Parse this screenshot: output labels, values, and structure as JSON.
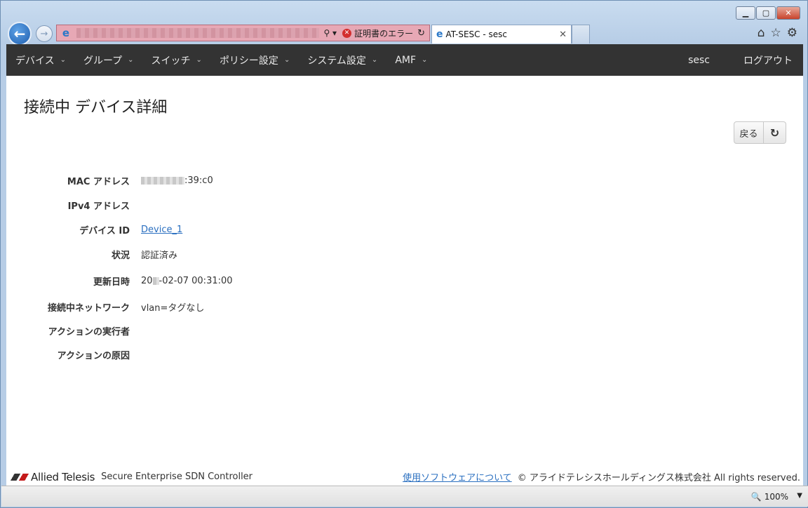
{
  "browser": {
    "address_error": "証明書のエラー",
    "tab_title": "AT-SESC - sesc",
    "zoom": "100%"
  },
  "nav": {
    "items": [
      {
        "label": "デバイス"
      },
      {
        "label": "グループ"
      },
      {
        "label": "スイッチ"
      },
      {
        "label": "ポリシー設定"
      },
      {
        "label": "システム設定"
      },
      {
        "label": "AMF"
      }
    ],
    "user": "sesc",
    "logout": "ログアウト"
  },
  "page": {
    "title": "接続中 デバイス詳細",
    "back_button": "戻る"
  },
  "details": {
    "mac_label": "MAC アドレス",
    "mac_value_suffix": ":39:c0",
    "ipv4_label": "IPv4 アドレス",
    "ipv4_value": "",
    "device_id_label": "デバイス ID",
    "device_id_value": "Device_1",
    "status_label": "状況",
    "status_value": "認証済み",
    "updated_label": "更新日時",
    "updated_prefix": "20",
    "updated_suffix": "-02-07 00:31:00",
    "network_label": "接続中ネットワーク",
    "network_value": "vlan=タグなし",
    "actor_label": "アクションの実行者",
    "cause_label": "アクションの原因"
  },
  "footer": {
    "brand": "Allied Telesis",
    "product": "Secure Enterprise SDN Controller",
    "software_link": "使用ソフトウェアについて",
    "copyright": "© アライドテレシスホールディングス株式会社 All rights reserved."
  }
}
